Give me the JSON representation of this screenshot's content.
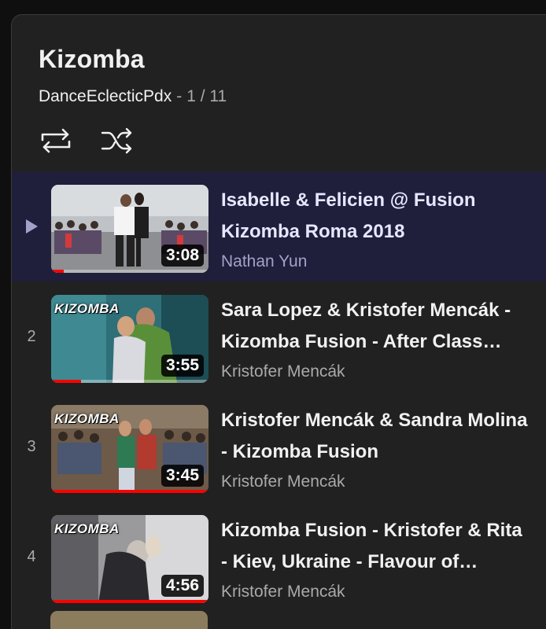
{
  "playlist": {
    "title": "Kizomba",
    "channel": "DanceEclecticPdx",
    "separator": "-",
    "position": "1 / 11"
  },
  "controls": {
    "loop_icon": "loop-icon",
    "shuffle_icon": "shuffle-icon"
  },
  "videos": [
    {
      "index": "▶",
      "title": "Isabelle & Felicien @ Fusion Kizomba Roma 2018",
      "channel": "Nathan Yun",
      "duration": "3:08",
      "tag": "",
      "watched_fraction": 0.08,
      "active": true
    },
    {
      "index": "2",
      "title": "Sara Lopez & Kristofer Mencák - Kizomba Fusion - After Class Demo",
      "channel": "Kristofer Mencák",
      "duration": "3:55",
      "tag": "KIZOMBA",
      "watched_fraction": 0.19,
      "active": false
    },
    {
      "index": "3",
      "title": "Kristofer Mencák & Sandra Molina - Kizomba Fusion",
      "channel": "Kristofer Mencák",
      "duration": "3:45",
      "tag": "KIZOMBA",
      "watched_fraction": 1.0,
      "active": false
    },
    {
      "index": "4",
      "title": "Kizomba Fusion - Kristofer & Rita - Kiev, Ukraine - Flavour of Kizomba",
      "channel": "Kristofer Mencák",
      "duration": "4:56",
      "tag": "KIZOMBA",
      "watched_fraction": 1.0,
      "active": false
    }
  ],
  "colors": {
    "active_row": "#1f1f3b",
    "progress": "#ff0000",
    "panel": "#212121"
  }
}
